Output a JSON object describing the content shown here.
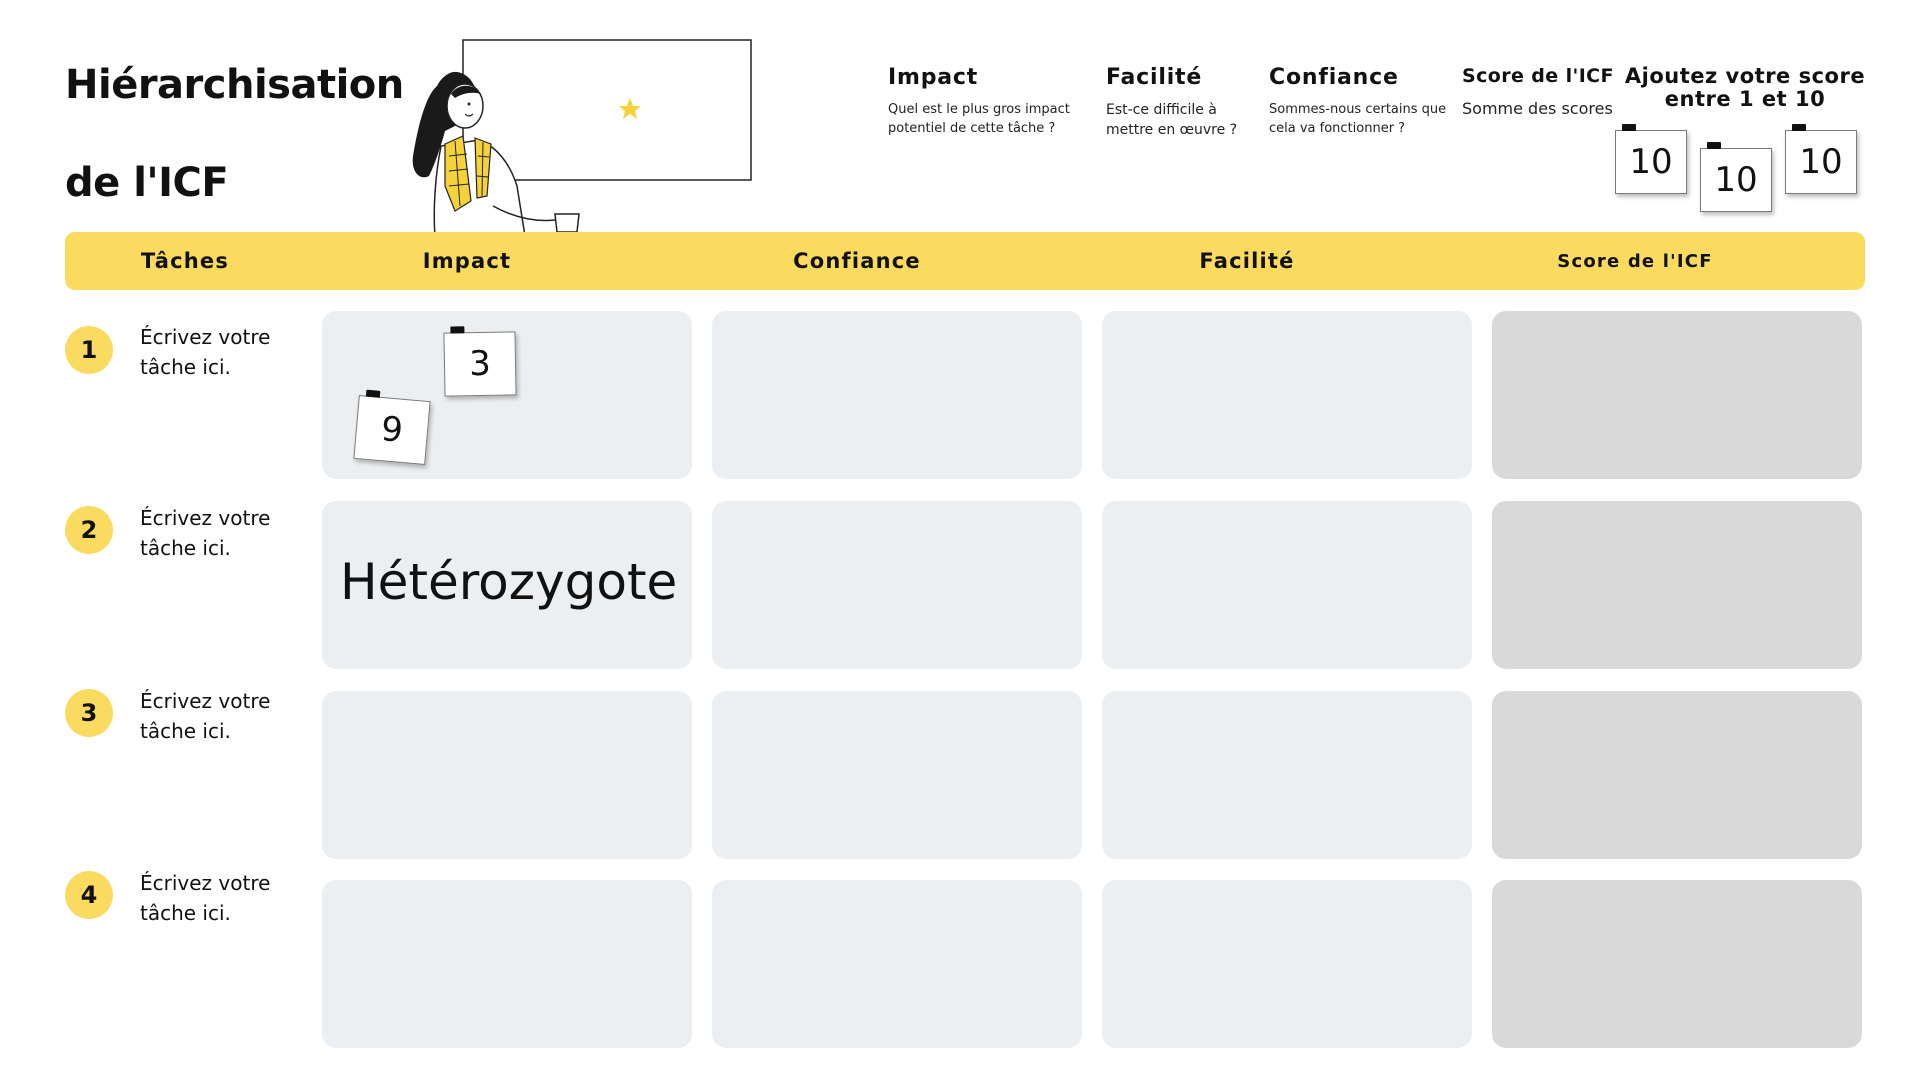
{
  "title": {
    "line1": "Hiérarchisation",
    "line2": "de l'ICF"
  },
  "legend": [
    {
      "heading": "Impact",
      "desc": "Quel est le plus gros impact potentiel de cette tâche ?"
    },
    {
      "heading": "Facilité",
      "desc": "Est-ce difficile à mettre en œuvre ?"
    },
    {
      "heading": "Confiance",
      "desc": "Sommes-nous certains que cela va fonctionner ?"
    },
    {
      "heading": "Score de l'ICF",
      "desc": "Somme des scores"
    }
  ],
  "score_prompt": "Ajoutez votre score entre 1 et 10",
  "score_notes": [
    "10",
    "10",
    "10"
  ],
  "header": [
    "Tâches",
    "Impact",
    "Confiance",
    "Facilité",
    "Score de l'ICF"
  ],
  "rows": [
    {
      "number": "1",
      "task": "Écrivez votre tâche ici.",
      "notes": [
        "3",
        "9"
      ],
      "impact_text": ""
    },
    {
      "number": "2",
      "task": "Écrivez votre tâche ici.",
      "notes": [],
      "impact_text": "Hétérozygote"
    },
    {
      "number": "3",
      "task": "Écrivez votre tâche ici.",
      "notes": [],
      "impact_text": ""
    },
    {
      "number": "4",
      "task": "Écrivez votre tâche ici.",
      "notes": [],
      "impact_text": ""
    }
  ],
  "colors": {
    "accent": "#fadb5f",
    "cell": "#eceff1",
    "score_cell": "#d9d9d9"
  }
}
